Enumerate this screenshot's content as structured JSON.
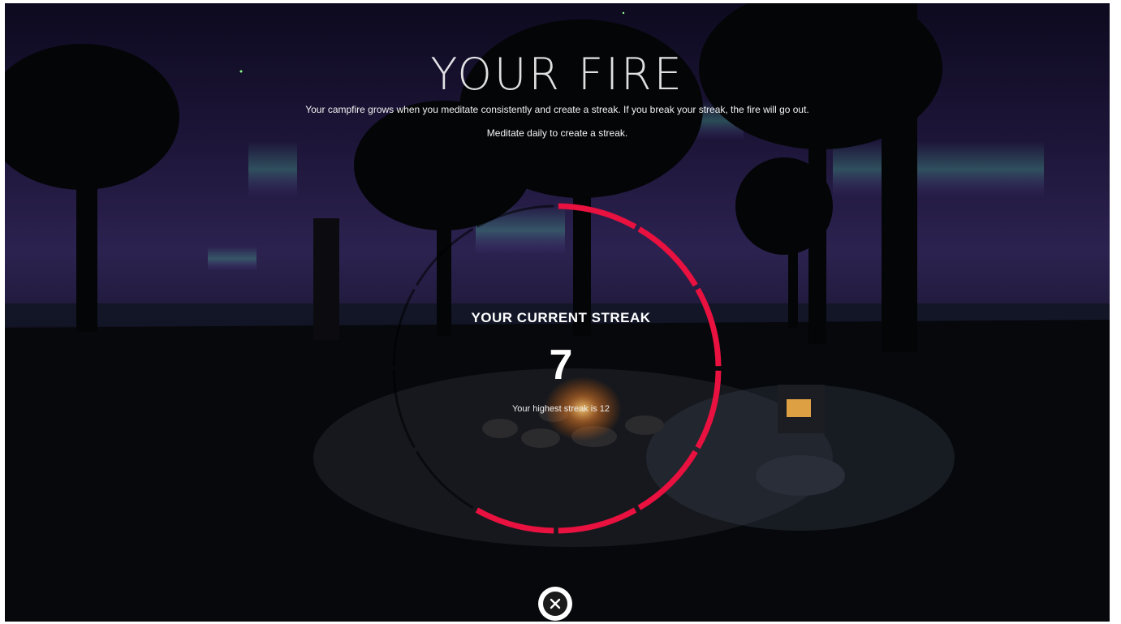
{
  "header": {
    "title": "YOUR FIRE",
    "description_1": "Your campfire grows when you meditate consistently and create a streak. If you break your streak, the fire will go out.",
    "description_2": "Meditate daily to create a streak."
  },
  "streak": {
    "label": "YOUR CURRENT STREAK",
    "current": "7",
    "highest_text": "Your highest streak is 12",
    "current_days": 7,
    "highest_days": 12
  },
  "colors": {
    "ring_active": "#e8113f",
    "ring_track": "#000000"
  },
  "icons": {
    "close": "close-icon"
  }
}
